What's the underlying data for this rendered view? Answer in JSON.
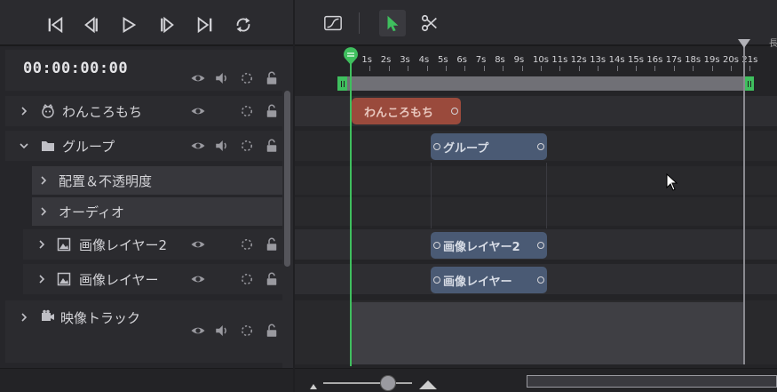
{
  "transport": {
    "buttons": [
      {
        "name": "skip-to-start-icon"
      },
      {
        "name": "step-back-icon"
      },
      {
        "name": "play-icon"
      },
      {
        "name": "step-forward-icon"
      },
      {
        "name": "skip-to-end-icon"
      },
      {
        "name": "loop-icon"
      }
    ]
  },
  "timecode": "00:00:00:00",
  "layers": [
    {
      "label": "わんころもち",
      "icon": "character-icon"
    },
    {
      "label": "グループ",
      "icon": "folder-icon"
    },
    {
      "label": "配置＆不透明度"
    },
    {
      "label": "オーディオ"
    },
    {
      "label": "画像レイヤー2",
      "icon": "image-icon"
    },
    {
      "label": "画像レイヤー",
      "icon": "image-icon"
    },
    {
      "label": "映像トラック",
      "icon": "video-track-icon"
    }
  ],
  "toolbar": {
    "tools": [
      "curve-editor-icon",
      "select-arrow-icon",
      "scissors-icon"
    ],
    "overflow_text": "長"
  },
  "ruler": {
    "ticks": [
      "1s",
      "2s",
      "3s",
      "4s",
      "5s",
      "6s",
      "7s",
      "8s",
      "9s",
      "10s",
      "11s",
      "12s",
      "13s",
      "14s",
      "15s",
      "16s",
      "17s",
      "18s",
      "19s",
      "20s",
      "21s"
    ]
  },
  "clips": {
    "wankoromochi": "わんころもち",
    "group": "グループ",
    "image2": "画像レイヤー2",
    "image1": "画像レイヤー"
  },
  "colors": {
    "accent_green": "#3fbf5e",
    "clip_red": "#9a4a3c",
    "clip_blue": "#4a5a74"
  }
}
